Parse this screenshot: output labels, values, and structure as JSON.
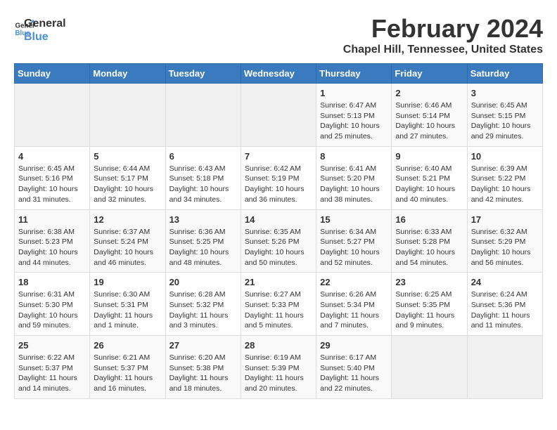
{
  "header": {
    "logo_line1": "General",
    "logo_line2": "Blue",
    "title": "February 2024",
    "subtitle": "Chapel Hill, Tennessee, United States"
  },
  "days_of_week": [
    "Sunday",
    "Monday",
    "Tuesday",
    "Wednesday",
    "Thursday",
    "Friday",
    "Saturday"
  ],
  "weeks": [
    [
      {
        "day": "",
        "empty": true
      },
      {
        "day": "",
        "empty": true
      },
      {
        "day": "",
        "empty": true
      },
      {
        "day": "",
        "empty": true
      },
      {
        "day": "1",
        "sunrise": "Sunrise: 6:47 AM",
        "sunset": "Sunset: 5:13 PM",
        "daylight": "Daylight: 10 hours and 25 minutes."
      },
      {
        "day": "2",
        "sunrise": "Sunrise: 6:46 AM",
        "sunset": "Sunset: 5:14 PM",
        "daylight": "Daylight: 10 hours and 27 minutes."
      },
      {
        "day": "3",
        "sunrise": "Sunrise: 6:45 AM",
        "sunset": "Sunset: 5:15 PM",
        "daylight": "Daylight: 10 hours and 29 minutes."
      }
    ],
    [
      {
        "day": "4",
        "sunrise": "Sunrise: 6:45 AM",
        "sunset": "Sunset: 5:16 PM",
        "daylight": "Daylight: 10 hours and 31 minutes."
      },
      {
        "day": "5",
        "sunrise": "Sunrise: 6:44 AM",
        "sunset": "Sunset: 5:17 PM",
        "daylight": "Daylight: 10 hours and 32 minutes."
      },
      {
        "day": "6",
        "sunrise": "Sunrise: 6:43 AM",
        "sunset": "Sunset: 5:18 PM",
        "daylight": "Daylight: 10 hours and 34 minutes."
      },
      {
        "day": "7",
        "sunrise": "Sunrise: 6:42 AM",
        "sunset": "Sunset: 5:19 PM",
        "daylight": "Daylight: 10 hours and 36 minutes."
      },
      {
        "day": "8",
        "sunrise": "Sunrise: 6:41 AM",
        "sunset": "Sunset: 5:20 PM",
        "daylight": "Daylight: 10 hours and 38 minutes."
      },
      {
        "day": "9",
        "sunrise": "Sunrise: 6:40 AM",
        "sunset": "Sunset: 5:21 PM",
        "daylight": "Daylight: 10 hours and 40 minutes."
      },
      {
        "day": "10",
        "sunrise": "Sunrise: 6:39 AM",
        "sunset": "Sunset: 5:22 PM",
        "daylight": "Daylight: 10 hours and 42 minutes."
      }
    ],
    [
      {
        "day": "11",
        "sunrise": "Sunrise: 6:38 AM",
        "sunset": "Sunset: 5:23 PM",
        "daylight": "Daylight: 10 hours and 44 minutes."
      },
      {
        "day": "12",
        "sunrise": "Sunrise: 6:37 AM",
        "sunset": "Sunset: 5:24 PM",
        "daylight": "Daylight: 10 hours and 46 minutes."
      },
      {
        "day": "13",
        "sunrise": "Sunrise: 6:36 AM",
        "sunset": "Sunset: 5:25 PM",
        "daylight": "Daylight: 10 hours and 48 minutes."
      },
      {
        "day": "14",
        "sunrise": "Sunrise: 6:35 AM",
        "sunset": "Sunset: 5:26 PM",
        "daylight": "Daylight: 10 hours and 50 minutes."
      },
      {
        "day": "15",
        "sunrise": "Sunrise: 6:34 AM",
        "sunset": "Sunset: 5:27 PM",
        "daylight": "Daylight: 10 hours and 52 minutes."
      },
      {
        "day": "16",
        "sunrise": "Sunrise: 6:33 AM",
        "sunset": "Sunset: 5:28 PM",
        "daylight": "Daylight: 10 hours and 54 minutes."
      },
      {
        "day": "17",
        "sunrise": "Sunrise: 6:32 AM",
        "sunset": "Sunset: 5:29 PM",
        "daylight": "Daylight: 10 hours and 56 minutes."
      }
    ],
    [
      {
        "day": "18",
        "sunrise": "Sunrise: 6:31 AM",
        "sunset": "Sunset: 5:30 PM",
        "daylight": "Daylight: 10 hours and 59 minutes."
      },
      {
        "day": "19",
        "sunrise": "Sunrise: 6:30 AM",
        "sunset": "Sunset: 5:31 PM",
        "daylight": "Daylight: 11 hours and 1 minute."
      },
      {
        "day": "20",
        "sunrise": "Sunrise: 6:28 AM",
        "sunset": "Sunset: 5:32 PM",
        "daylight": "Daylight: 11 hours and 3 minutes."
      },
      {
        "day": "21",
        "sunrise": "Sunrise: 6:27 AM",
        "sunset": "Sunset: 5:33 PM",
        "daylight": "Daylight: 11 hours and 5 minutes."
      },
      {
        "day": "22",
        "sunrise": "Sunrise: 6:26 AM",
        "sunset": "Sunset: 5:34 PM",
        "daylight": "Daylight: 11 hours and 7 minutes."
      },
      {
        "day": "23",
        "sunrise": "Sunrise: 6:25 AM",
        "sunset": "Sunset: 5:35 PM",
        "daylight": "Daylight: 11 hours and 9 minutes."
      },
      {
        "day": "24",
        "sunrise": "Sunrise: 6:24 AM",
        "sunset": "Sunset: 5:36 PM",
        "daylight": "Daylight: 11 hours and 11 minutes."
      }
    ],
    [
      {
        "day": "25",
        "sunrise": "Sunrise: 6:22 AM",
        "sunset": "Sunset: 5:37 PM",
        "daylight": "Daylight: 11 hours and 14 minutes."
      },
      {
        "day": "26",
        "sunrise": "Sunrise: 6:21 AM",
        "sunset": "Sunset: 5:37 PM",
        "daylight": "Daylight: 11 hours and 16 minutes."
      },
      {
        "day": "27",
        "sunrise": "Sunrise: 6:20 AM",
        "sunset": "Sunset: 5:38 PM",
        "daylight": "Daylight: 11 hours and 18 minutes."
      },
      {
        "day": "28",
        "sunrise": "Sunrise: 6:19 AM",
        "sunset": "Sunset: 5:39 PM",
        "daylight": "Daylight: 11 hours and 20 minutes."
      },
      {
        "day": "29",
        "sunrise": "Sunrise: 6:17 AM",
        "sunset": "Sunset: 5:40 PM",
        "daylight": "Daylight: 11 hours and 22 minutes."
      },
      {
        "day": "",
        "empty": true
      },
      {
        "day": "",
        "empty": true
      }
    ]
  ]
}
